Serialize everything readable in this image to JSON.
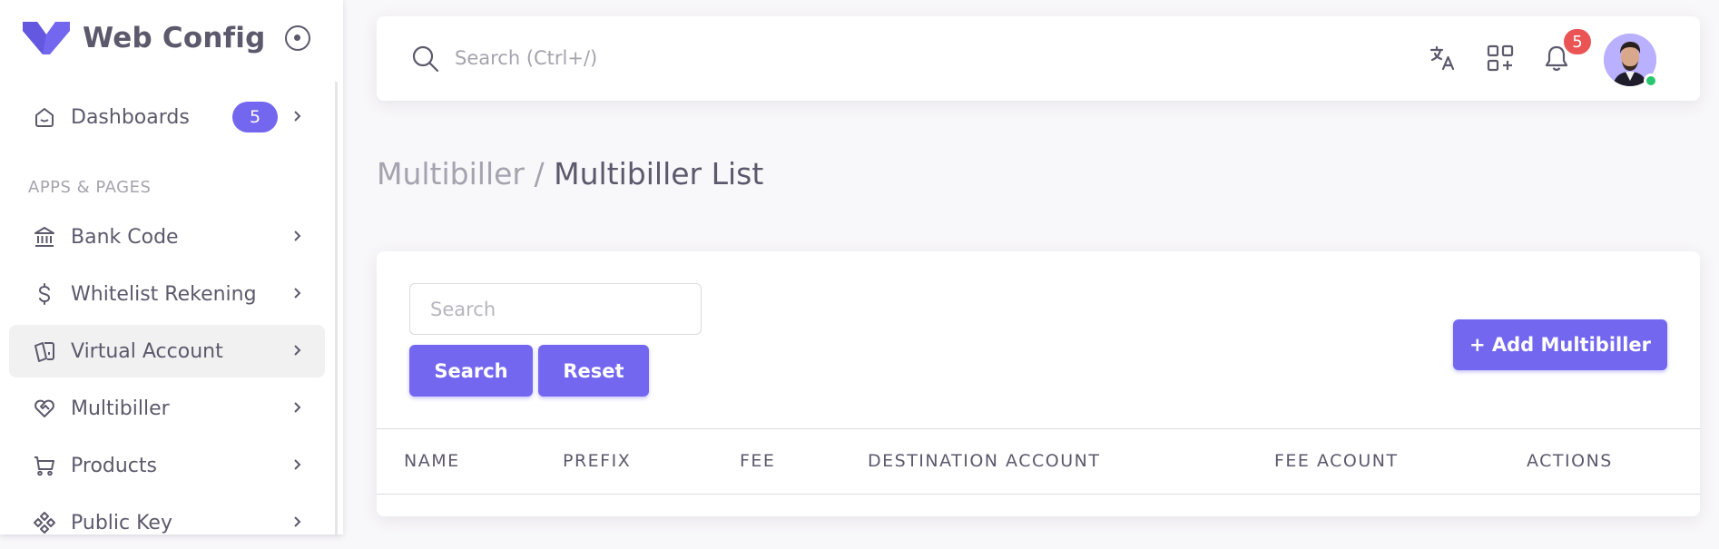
{
  "sidebar": {
    "brand": "Web Config",
    "section_title": "APPS & PAGES",
    "items": [
      {
        "label": "Dashboards",
        "icon": "home-icon",
        "badge": "5"
      },
      {
        "label": "Bank Code",
        "icon": "bank-icon"
      },
      {
        "label": "Whitelist Rekening",
        "icon": "dollar-icon"
      },
      {
        "label": "Virtual Account",
        "icon": "cards-icon"
      },
      {
        "label": "Multibiller",
        "icon": "heart-handshake-icon"
      },
      {
        "label": "Products",
        "icon": "shopping-cart-icon"
      },
      {
        "label": "Public Key",
        "icon": "components-icon"
      }
    ]
  },
  "topbar": {
    "search_placeholder": "Search (Ctrl+/)",
    "notification_count": "5"
  },
  "breadcrumb": {
    "parent": "Multibiller",
    "separator": "/",
    "current": "Multibiller List"
  },
  "card": {
    "search_placeholder": "Search",
    "search_button": "Search",
    "reset_button": "Reset",
    "add_button": "+ Add Multibiller",
    "columns": [
      "NAME",
      "PREFIX",
      "FEE",
      "DESTINATION ACCOUNT",
      "FEE ACOUNT",
      "ACTIONS"
    ]
  },
  "colors": {
    "primary": "#7367f0",
    "danger": "#ea5455",
    "success": "#28c76f",
    "text": "#5d596c",
    "muted": "#a5a3ae"
  }
}
